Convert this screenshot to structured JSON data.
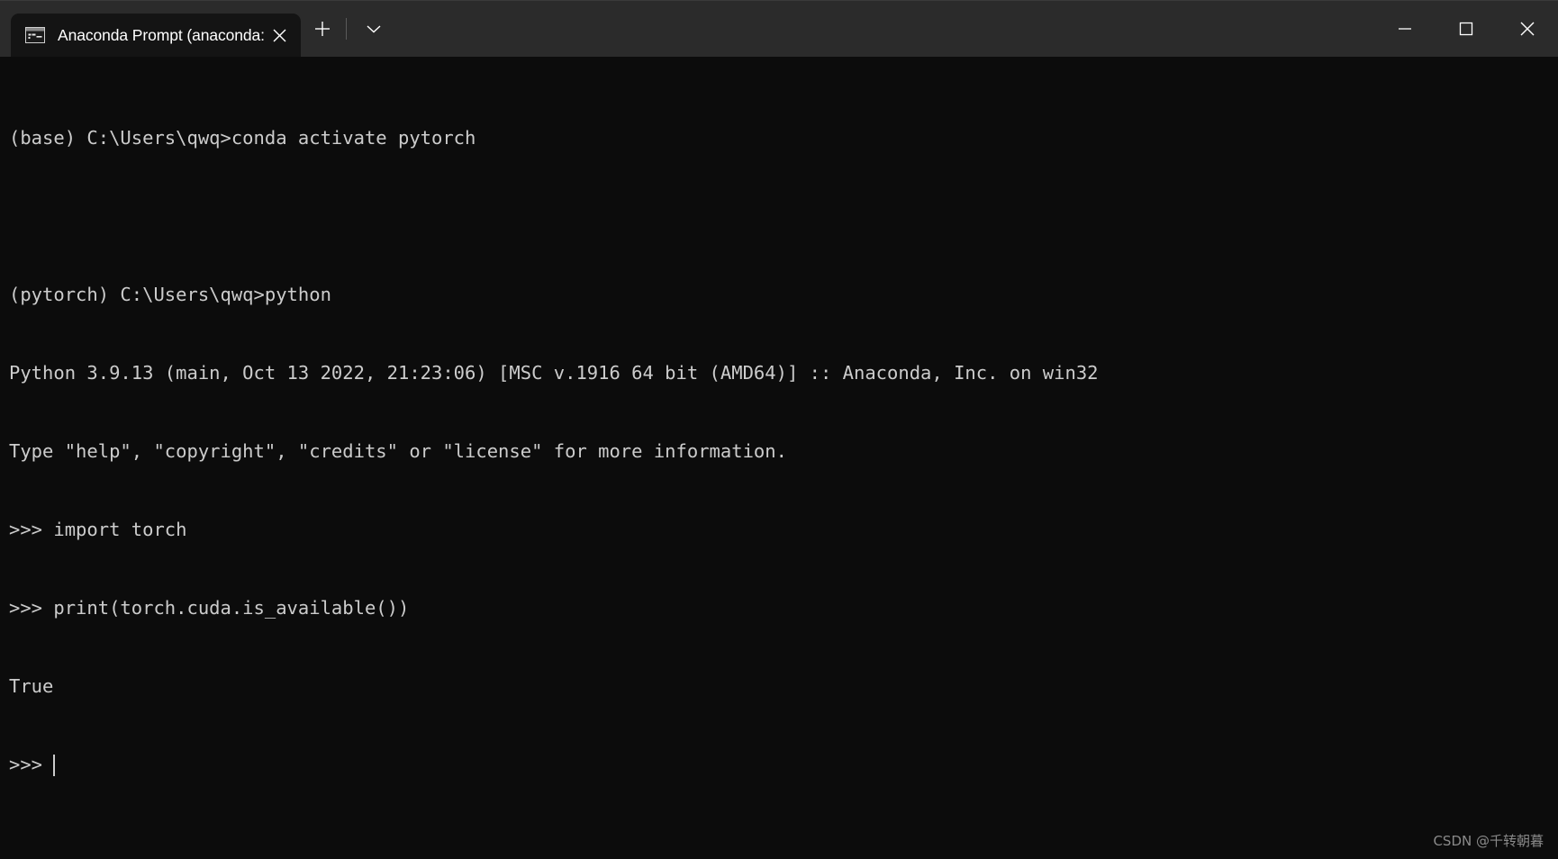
{
  "window": {
    "background_color": "#0c0c0c",
    "titlebar_color": "#2b2b2b",
    "text_color": "#cccccc"
  },
  "titlebar": {
    "tab": {
      "icon": "console-window-icon",
      "title": "Anaconda Prompt (anaconda:",
      "close_label": "✕"
    },
    "new_tab_label": "+",
    "dropdown_label": "⌄",
    "minimize_label": "─",
    "maximize_label": "☐",
    "close_label": "✕"
  },
  "terminal": {
    "lines": [
      "(base) C:\\Users\\qwq>conda activate pytorch",
      "",
      "(pytorch) C:\\Users\\qwq>python",
      "Python 3.9.13 (main, Oct 13 2022, 21:23:06) [MSC v.1916 64 bit (AMD64)] :: Anaconda, Inc. on win32",
      "Type \"help\", \"copyright\", \"credits\" or \"license\" for more information.",
      ">>> import torch",
      ">>> print(torch.cuda.is_available())",
      "True"
    ],
    "prompt": ">>>",
    "cursor": "|"
  },
  "watermark": {
    "text": "CSDN @千转朝暮"
  }
}
